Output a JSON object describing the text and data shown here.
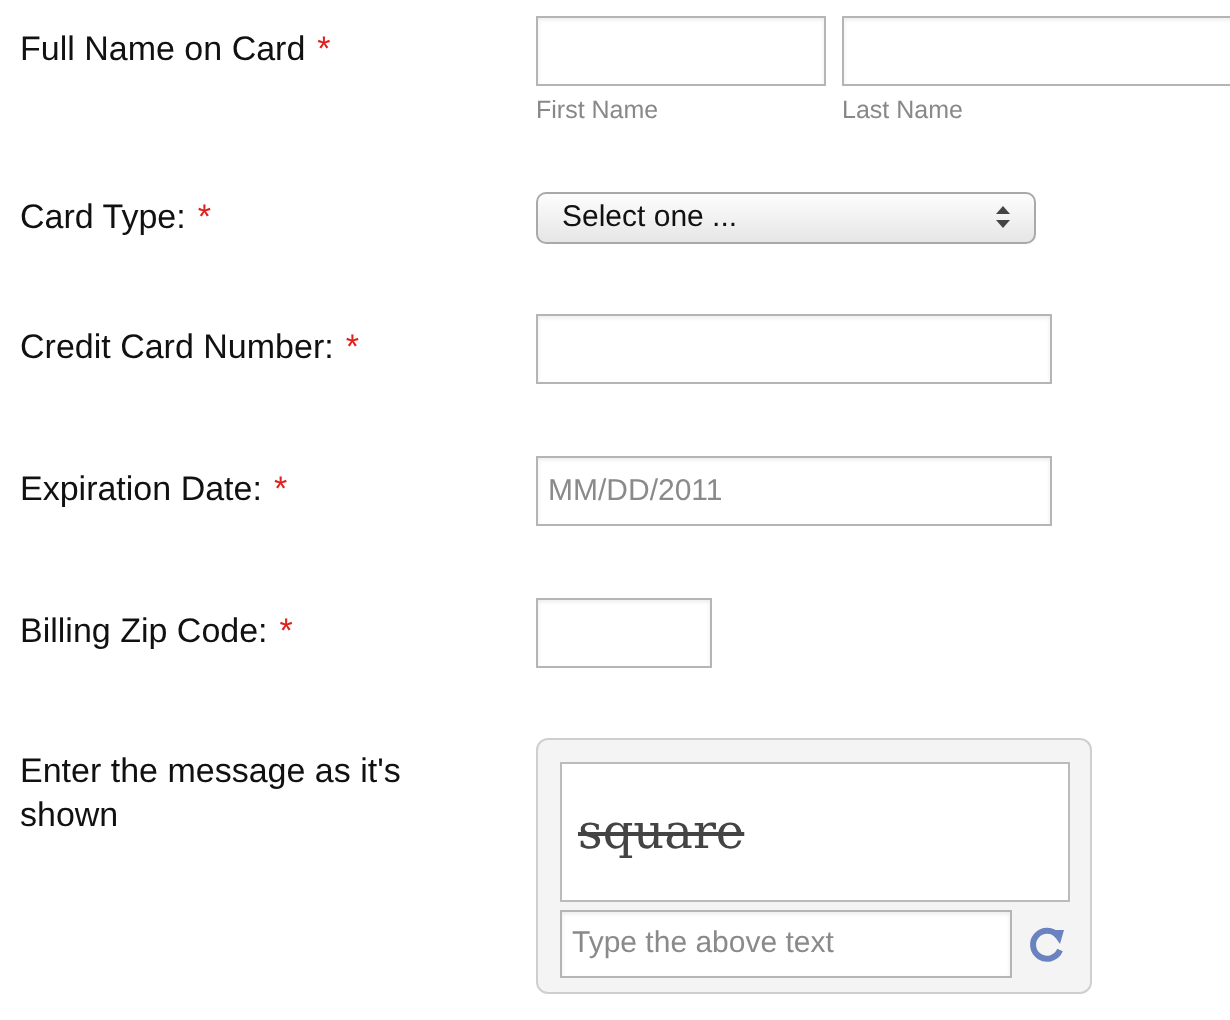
{
  "fields": [
    {
      "kind": "name",
      "label": "Full Name on Card",
      "required_mark": "*",
      "parts": [
        {
          "sublabel": "First Name"
        },
        {
          "sublabel": "Last Name"
        }
      ]
    },
    {
      "kind": "select",
      "label": "Card Type:",
      "required_mark": "*",
      "value": "Select one ..."
    },
    {
      "kind": "text",
      "label": "Credit Card Number:",
      "required_mark": "*"
    },
    {
      "kind": "text",
      "label": "Expiration Date:",
      "required_mark": "*",
      "placeholder": "MM/DD/2011"
    },
    {
      "kind": "shorttext",
      "label": "Billing Zip Code:",
      "required_mark": "*"
    },
    {
      "kind": "captcha",
      "label": "Enter the message as it's shown",
      "captcha": "square",
      "placeholder": "Type the above text"
    }
  ]
}
